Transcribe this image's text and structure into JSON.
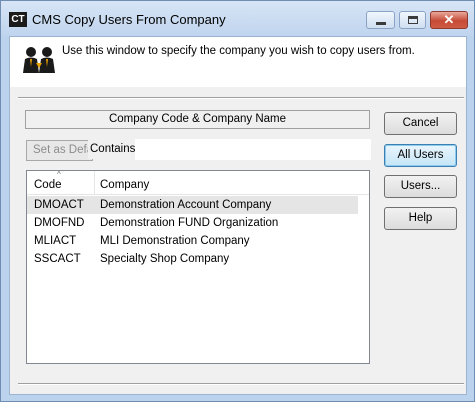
{
  "window": {
    "app_badge": "CT",
    "title": "CMS Copy Users From Company"
  },
  "header": {
    "icon": "users-icon",
    "instructions": "Use this window to specify the company you wish to copy users from."
  },
  "filter": {
    "field_label": "Company Code & Company Name",
    "set_default_label": "Set as Default",
    "match_mode": "Contains",
    "value": ""
  },
  "list": {
    "columns": [
      "Code",
      "Company"
    ],
    "rows": [
      {
        "code": "DMOACT",
        "name": "Demonstration Account Company"
      },
      {
        "code": "DMOFND",
        "name": "Demonstration FUND Organization"
      },
      {
        "code": "MLIACT",
        "name": "MLI Demonstration Company"
      },
      {
        "code": "SSCACT",
        "name": "Specialty Shop Company"
      }
    ],
    "selected_index": 0
  },
  "buttons": {
    "cancel": "Cancel",
    "all_users": "All Users",
    "users": "Users...",
    "help": "Help"
  },
  "colors": {
    "titlebar": "#bfd4ee",
    "close_button": "#c64b36",
    "default_button_border": "#3c7fb1",
    "selected_row": "#e5e5e5"
  }
}
